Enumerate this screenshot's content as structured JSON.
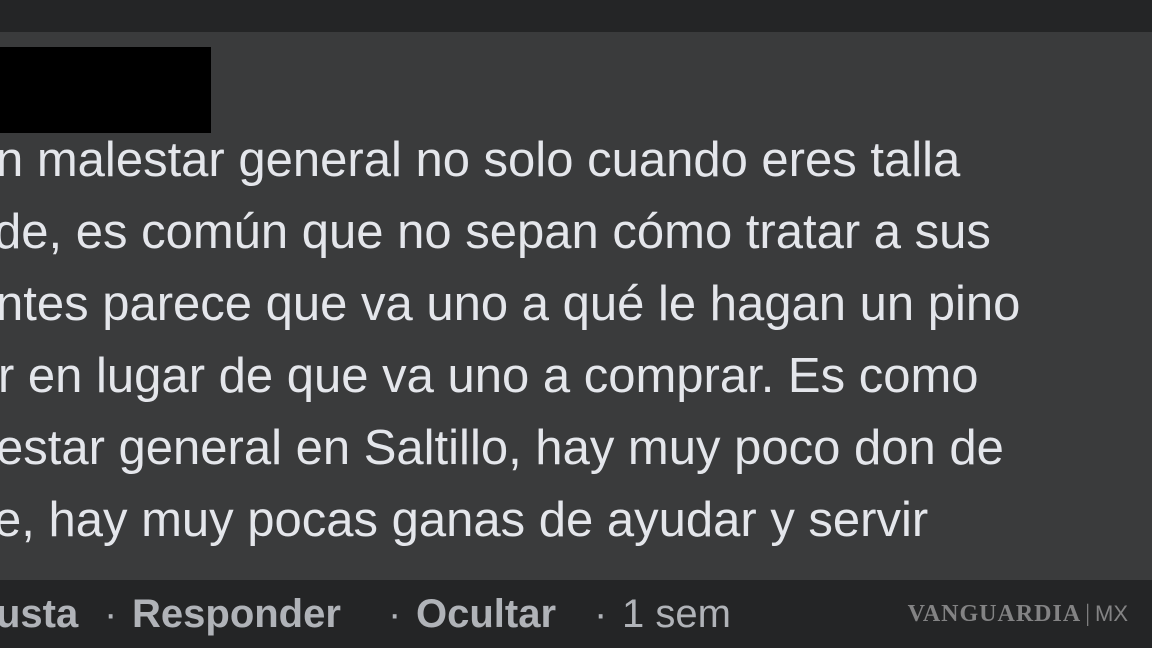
{
  "comment": {
    "lines": [
      "n malestar general no solo cuando eres talla",
      "de, es común que no sepan cómo tratar a sus",
      "ntes parece que va uno a qué le hagan un pino",
      "r en lugar de que va uno a comprar. Es como",
      "estar general en Saltillo, hay muy poco don de",
      "e, hay muy pocas ganas de ayudar y servir"
    ]
  },
  "actions": {
    "like_label": "usta",
    "reply_label": "Responder",
    "hide_label": "Ocultar",
    "separator": "·",
    "timestamp": "1 sem"
  },
  "watermark": {
    "brand": "VANGUARDIA",
    "divider": "|",
    "suffix": "MX"
  },
  "colors": {
    "background": "#242526",
    "bubble": "#3a3b3c",
    "text": "#e4e6eb",
    "secondary_text": "#b0b3b8",
    "redaction": "#000000"
  }
}
